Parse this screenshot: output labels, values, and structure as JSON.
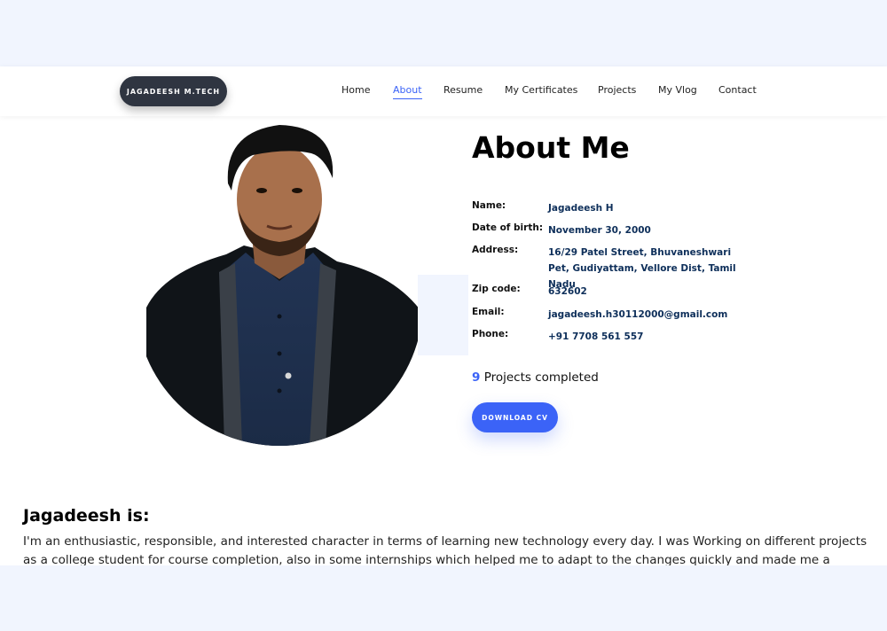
{
  "brand": "JAGADEESH M.TECH",
  "nav": [
    {
      "label": "Home",
      "active": false
    },
    {
      "label": "About",
      "active": true
    },
    {
      "label": "Resume",
      "active": false
    },
    {
      "label": "My Certificates",
      "active": false
    },
    {
      "label": "Projects",
      "active": false
    },
    {
      "label": "My Vlog",
      "active": false
    },
    {
      "label": "Contact",
      "active": false
    }
  ],
  "about": {
    "title": "About Me",
    "info": [
      {
        "label": "Name:",
        "value": "Jagadeesh H"
      },
      {
        "label": "Date of birth:",
        "value": "November 30, 2000"
      },
      {
        "label": "Address:",
        "value": "16/29 Patel Street, Bhuvaneshwari Pet, Gudiyattam, Vellore Dist, Tamil Nadu"
      },
      {
        "label": "Zip code:",
        "value": "632602"
      },
      {
        "label": "Email:",
        "value": "jagadeesh.h30112000@gmail.com"
      },
      {
        "label": "Phone:",
        "value": "+91 7708 561 557"
      }
    ],
    "projects_count": "9",
    "projects_text": " Projects completed",
    "cv_button": "DOWNLOAD CV"
  },
  "bio": {
    "heading": "Jagadeesh is:",
    "text": "I'm an enthusiastic, responsible, and interested character in terms of learning new technology every day. I was Working on different projects as a college student for course completion, also in some internships which helped me to adapt to the changes quickly and made me a mature team"
  },
  "colors": {
    "accent": "#3b63f7",
    "brand_bg": "#2f3541",
    "value_text": "#0e2f5a",
    "page_band": "#f1f5fe"
  }
}
